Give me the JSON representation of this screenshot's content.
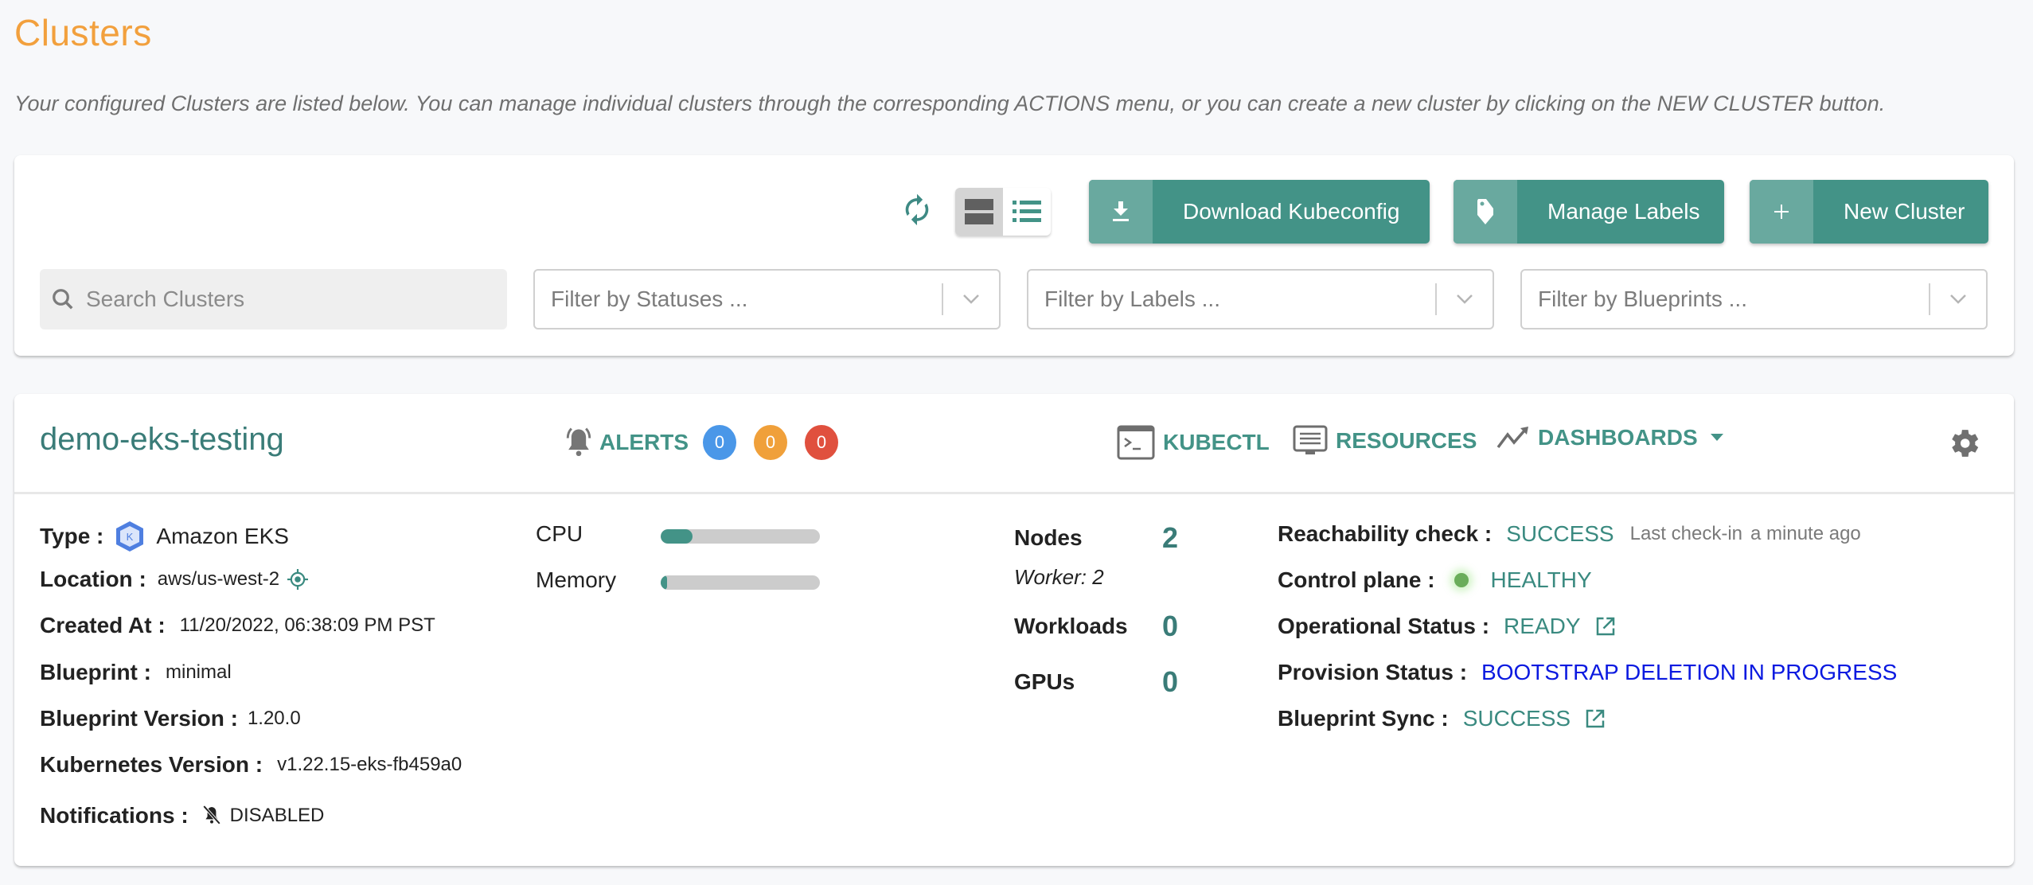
{
  "page": {
    "title": "Clusters",
    "description": "Your configured Clusters are listed below. You can manage individual clusters through the corresponding ACTIONS menu, or you can create a new cluster by clicking on the NEW CLUSTER button."
  },
  "toolbar": {
    "refresh_icon": "refresh-icon",
    "view_modes": [
      {
        "name": "card-view",
        "icon": "grid-view-icon",
        "active": true
      },
      {
        "name": "list-view",
        "icon": "list-view-icon",
        "active": false
      }
    ],
    "buttons": {
      "download_kubeconfig": "Download Kubeconfig",
      "manage_labels": "Manage Labels",
      "new_cluster": "New Cluster"
    },
    "search": {
      "placeholder": "Search Clusters",
      "value": ""
    },
    "filters": {
      "statuses": "Filter by Statuses ...",
      "labels": "Filter by Labels ...",
      "blueprints": "Filter by Blueprints ..."
    }
  },
  "cluster": {
    "name": "demo-eks-testing",
    "alerts": {
      "label": "ALERTS",
      "counts": [
        {
          "value": "0",
          "color": "#4a97e8"
        },
        {
          "value": "0",
          "color": "#f0a03a"
        },
        {
          "value": "0",
          "color": "#e0503e"
        }
      ]
    },
    "actions": {
      "kubectl": "KUBECTL",
      "resources": "RESOURCES",
      "dashboards": "DASHBOARDS"
    },
    "details": {
      "type_label": "Type :",
      "type_value": "Amazon EKS",
      "location_label": "Location :",
      "location_value": "aws/us-west-2",
      "created_label": "Created At :",
      "created_value": "11/20/2022, 06:38:09 PM PST",
      "blueprint_label": "Blueprint :",
      "blueprint_value": "minimal",
      "blueprint_version_label": "Blueprint Version :",
      "blueprint_version_value": "1.20.0",
      "k8s_version_label": "Kubernetes Version :",
      "k8s_version_value": "v1.22.15-eks-fb459a0",
      "notifications_label": "Notifications :",
      "notifications_value": "DISABLED"
    },
    "resources": {
      "cpu_label": "CPU",
      "cpu_usage_percent": 20,
      "memory_label": "Memory",
      "memory_usage_percent": 4
    },
    "stats": {
      "nodes_label": "Nodes",
      "nodes_value": "2",
      "worker_text": "Worker: 2",
      "workloads_label": "Workloads",
      "workloads_value": "0",
      "gpus_label": "GPUs",
      "gpus_value": "0"
    },
    "status": {
      "reachability_label": "Reachability check :",
      "reachability_value": "SUCCESS",
      "last_checkin_label": "Last check-in",
      "last_checkin_value": "a minute ago",
      "control_plane_label": "Control plane :",
      "control_plane_value": "HEALTHY",
      "operational_label": "Operational Status :",
      "operational_value": "READY",
      "provision_label": "Provision Status :",
      "provision_value": "BOOTSTRAP DELETION IN PROGRESS",
      "blueprint_sync_label": "Blueprint Sync :",
      "blueprint_sync_value": "SUCCESS"
    }
  },
  "colors": {
    "title": "#f2a03d",
    "accent": "#439387",
    "accent_light": "#69a99f",
    "link_blue": "#0a19e0",
    "healthy_dot": "#6aad5a"
  }
}
